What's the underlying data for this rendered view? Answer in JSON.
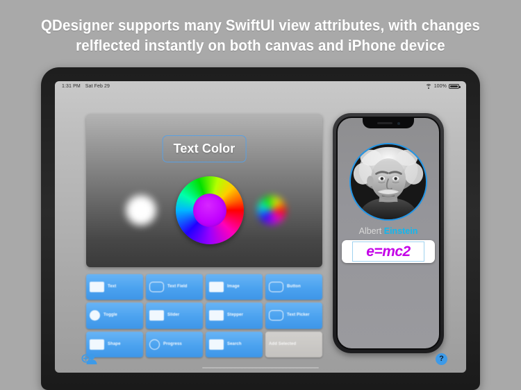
{
  "headline": {
    "line1": "QDesigner supports many SwiftUI view attributes, with changes",
    "line2": "relflected instantly on both canvas and iPhone device"
  },
  "colors": {
    "page_background": "#a9a9a9",
    "headline_text": "#ffffff",
    "accent_blue": "#4ba2ef",
    "border_blue": "#5a9fe0",
    "name_accent": "#12b7ef",
    "formula_magenta": "#c400e8",
    "portrait_ring": "#2196e8",
    "disabled_gray": "#c4c2bf"
  },
  "ipad": {
    "status_bar": {
      "time": "1:31 PM",
      "date": "Sat Feb 29",
      "wifi_icon": "wifi-icon",
      "battery_percent": "100%",
      "battery_icon": "battery-full-icon"
    },
    "canvas": {
      "text_color_label": "Text Color",
      "swatches": [
        {
          "name": "white-blur-swatch",
          "kind": "blurred-white-circle"
        },
        {
          "name": "color-wheel-large",
          "kind": "color-wheel",
          "center_color": "#c000ff"
        },
        {
          "name": "color-wheel-small",
          "kind": "blurred-color-wheel"
        }
      ]
    },
    "tool_grid": {
      "buttons": [
        {
          "label": "Text",
          "icon": "abc-text-icon",
          "icon_shape": "rect",
          "enabled": true
        },
        {
          "label": "Text Field",
          "icon": "text-field-icon",
          "icon_shape": "hollow-soft",
          "enabled": true
        },
        {
          "label": "Image",
          "icon": "image-icon",
          "icon_shape": "rect",
          "enabled": true
        },
        {
          "label": "Button",
          "icon": "button-icon",
          "icon_shape": "hollow-soft",
          "enabled": true
        },
        {
          "label": "Toggle",
          "icon": "toggle-icon",
          "icon_shape": "round",
          "enabled": true
        },
        {
          "label": "Slider",
          "icon": "slider-icon",
          "icon_shape": "rect",
          "enabled": true
        },
        {
          "label": "Stepper",
          "icon": "stepper-icon",
          "icon_shape": "rect",
          "enabled": true
        },
        {
          "label": "Text Picker",
          "icon": "text-picker-icon",
          "icon_shape": "hollow-soft",
          "enabled": true
        },
        {
          "label": "Shape",
          "icon": "shape-icon",
          "icon_shape": "rect",
          "enabled": true
        },
        {
          "label": "Progress",
          "icon": "progress-icon",
          "icon_shape": "hollow-round",
          "enabled": true
        },
        {
          "label": "Search",
          "icon": "search-icon",
          "icon_shape": "rect",
          "enabled": true
        },
        {
          "label": "Add Selected",
          "icon": "add-selected-icon",
          "icon_shape": "none",
          "enabled": false
        }
      ]
    },
    "footer": {
      "add_person_icon": "add-person-icon",
      "help_label": "?"
    }
  },
  "iphone": {
    "notch": {
      "speaker_icon": "speaker-grille-icon",
      "camera_icon": "front-camera-icon"
    },
    "portrait": {
      "icon": "einstein-portrait-image",
      "alt": "Albert Einstein portrait"
    },
    "name": {
      "first": "Albert",
      "last": "Einstein"
    },
    "formula_field": {
      "value": "e=mc2"
    }
  }
}
